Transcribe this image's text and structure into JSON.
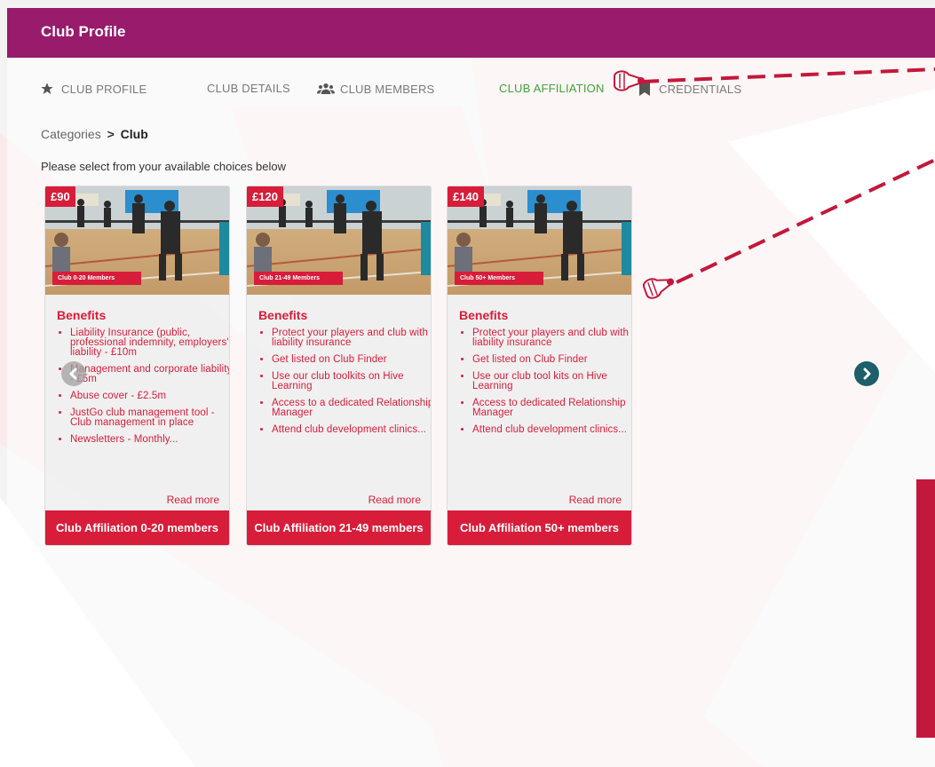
{
  "header": {
    "title": "Club Profile"
  },
  "tabs": [
    {
      "label": "CLUB PROFILE",
      "icon": "star-icon"
    },
    {
      "label": "CLUB DETAILS"
    },
    {
      "label": "CLUB MEMBERS",
      "icon": "users-icon"
    },
    {
      "label": "CLUB AFFILIATION",
      "active": true
    },
    {
      "label": "CREDENTIALS",
      "icon": "bookmark-icon"
    }
  ],
  "breadcrumb": {
    "root": "Categories",
    "separator": ">",
    "current": "Club"
  },
  "instruction": "Please select from your available choices below",
  "cards": [
    {
      "price": "£90",
      "tag": "Club 0-20 Members",
      "benefits_title": "Benefits",
      "benefits": [
        "Liability Insurance (public, professional indemnity, employers' liability - £10m",
        "Management and corporate liability - £5m",
        "Abuse cover - £2.5m",
        "JustGo club management tool - Club management in place",
        "Newsletters - Monthly..."
      ],
      "read_more": "Read more",
      "footer": "Club Affiliation 0-20 members"
    },
    {
      "price": "£120",
      "tag": "Club 21-49 Members",
      "benefits_title": "Benefits",
      "benefits": [
        "Protect your players and club with liability insurance",
        "Get listed on Club Finder",
        "Use our club toolkits on Hive Learning",
        "Access to a dedicated Relationship Manager",
        "Attend club development clinics..."
      ],
      "read_more": "Read more",
      "footer": "Club Affiliation 21-49 members"
    },
    {
      "price": "£140",
      "tag": "Club 50+ Members",
      "benefits_title": "Benefits",
      "benefits": [
        "Protect your players and club with liability insurance",
        "Get listed on Club Finder",
        "Use our club tool kits on Hive Learning",
        "Access to dedicated Relationship Manager",
        "Attend club development clinics..."
      ],
      "read_more": "Read more",
      "footer": "Club Affiliation 50+ members"
    }
  ],
  "carousel": {
    "prev_icon": "chevron-left-icon",
    "next_icon": "chevron-right-icon"
  },
  "colors": {
    "header": "#981b6c",
    "accent_red": "#d81d3a",
    "active_tab": "#3fa33a",
    "next_button": "#1c5e69"
  }
}
